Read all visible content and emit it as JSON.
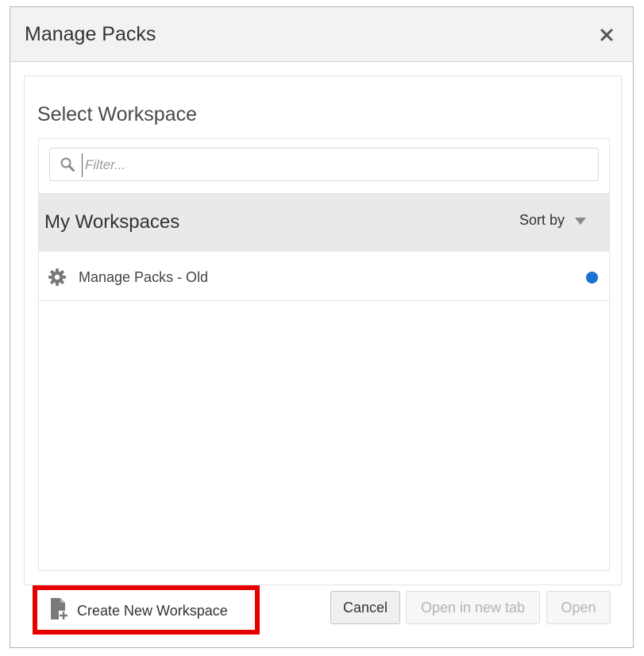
{
  "dialog": {
    "title": "Manage Packs",
    "close_icon": "close-icon"
  },
  "panel": {
    "title": "Select Workspace"
  },
  "filter": {
    "placeholder": "Filter...",
    "value": "",
    "icon": "search-icon"
  },
  "group": {
    "title": "My Workspaces",
    "sort_label": "Sort by",
    "sort_icon": "caret-down-icon"
  },
  "workspaces": [
    {
      "name": "Manage Packs - Old",
      "icon": "gear-icon",
      "status_color": "#1a73d1"
    }
  ],
  "footer": {
    "create_label": "Create New Workspace",
    "create_icon": "new-document-icon",
    "cancel_label": "Cancel",
    "open_new_tab_label": "Open in new tab",
    "open_label": "Open"
  },
  "colors": {
    "highlight": "#e60000",
    "accent": "#1a73d1"
  }
}
